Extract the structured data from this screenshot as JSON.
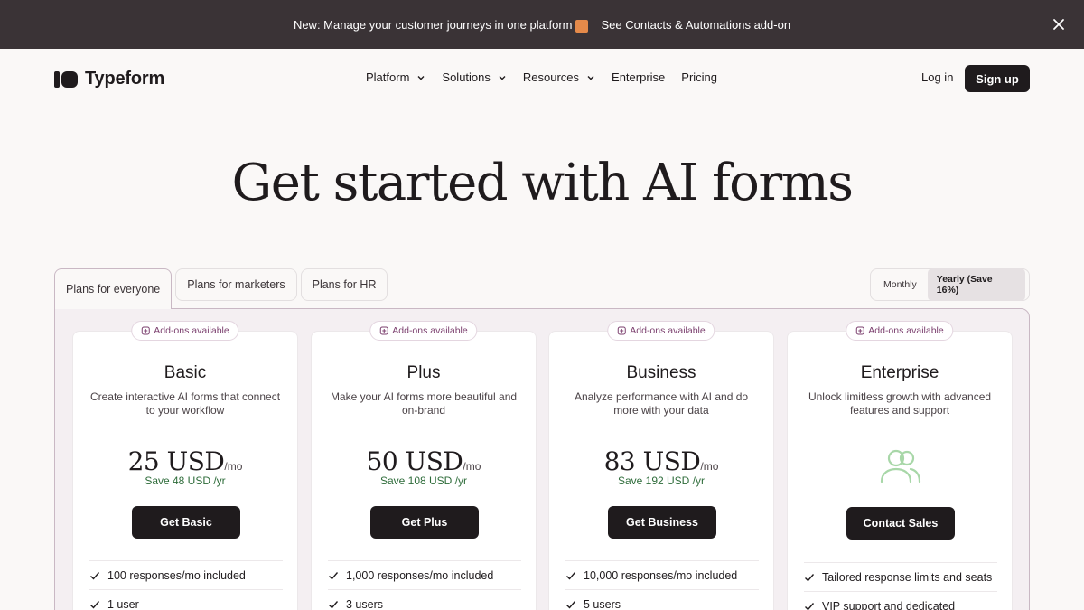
{
  "announcement": {
    "text": "New: Manage your customer journeys in one platform",
    "link": "See Contacts & Automations add-on",
    "close_icon": "close-icon"
  },
  "header": {
    "brand": "Typeform",
    "nav": [
      {
        "label": "Platform",
        "has_dropdown": true
      },
      {
        "label": "Solutions",
        "has_dropdown": true
      },
      {
        "label": "Resources",
        "has_dropdown": true
      },
      {
        "label": "Enterprise",
        "has_dropdown": false
      },
      {
        "label": "Pricing",
        "has_dropdown": false
      }
    ],
    "login": "Log in",
    "signup": "Sign up"
  },
  "hero": {
    "title": "Get started with AI forms"
  },
  "tabs": [
    "Plans for everyone",
    "Plans for marketers",
    "Plans for HR"
  ],
  "billing": {
    "monthly": "Monthly",
    "yearly": "Yearly (Save 16%)",
    "selected": "yearly"
  },
  "plans": [
    {
      "addon": "Add-ons available",
      "title": "Basic",
      "desc": "Create interactive AI forms that connect to your workflow",
      "amount": "25 USD",
      "per": "/mo",
      "save": "Save 48 USD /yr",
      "cta": "Get Basic",
      "features": [
        "100 responses/mo included",
        "1 user"
      ]
    },
    {
      "addon": "Add-ons available",
      "title": "Plus",
      "desc": "Make your AI forms more beautiful and on-brand",
      "amount": "50 USD",
      "per": "/mo",
      "save": "Save 108 USD /yr",
      "cta": "Get Plus",
      "features": [
        "1,000 responses/mo included",
        "3 users"
      ]
    },
    {
      "addon": "Add-ons available",
      "title": "Business",
      "desc": "Analyze performance with AI and do more with your data",
      "amount": "83 USD",
      "per": "/mo",
      "save": "Save 192 USD /yr",
      "cta": "Get Business",
      "features": [
        "10,000 responses/mo included",
        "5 users"
      ]
    },
    {
      "addon": "Add-ons available",
      "title": "Enterprise",
      "desc": "Unlock limitless growth with advanced features and support",
      "cta": "Contact Sales",
      "features": [
        "Tailored response limits and seats",
        "VIP support and dedicated"
      ]
    }
  ],
  "colors": {
    "announce_bg": "#3a3336",
    "accent_text": "#7b3f6e",
    "save_text": "#2e6c3a",
    "icon_green": "#a8d7a8"
  }
}
